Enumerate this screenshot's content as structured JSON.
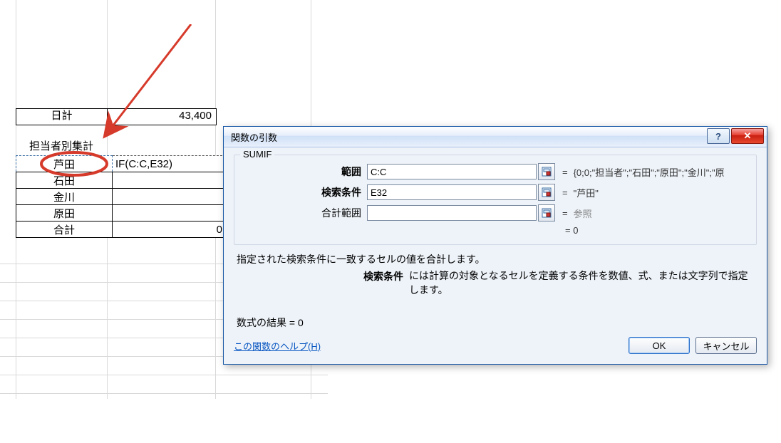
{
  "sheet": {
    "peek": {
      "label": "日計",
      "value": "43,400"
    },
    "header": "担当者別集計",
    "rows": [
      {
        "name": "芦田",
        "formula": "IF(C:C,E32)"
      },
      {
        "name": "石田",
        "formula": ""
      },
      {
        "name": "金川",
        "formula": ""
      },
      {
        "name": "原田",
        "formula": ""
      },
      {
        "name": "合計",
        "formula": "0"
      }
    ]
  },
  "dialog": {
    "title": "関数の引数",
    "function_name": "SUMIF",
    "args": [
      {
        "label": "範囲",
        "value": "C:C",
        "result": "{0;0;\"担当者\";\"石田\";\"原田\";\"金川\";\"原"
      },
      {
        "label": "検索条件",
        "value": "E32",
        "result": "\"芦田\""
      },
      {
        "label": "合計範囲",
        "value": "",
        "result": "参照"
      }
    ],
    "overall_eq": "=  0",
    "description_main": "指定された検索条件に一致するセルの値を合計します。",
    "description_arg_label": "検索条件",
    "description_arg_text": "には計算の対象となるセルを定義する条件を数値、式、または文字列で指定します。",
    "formula_result_label": "数式の結果 = ",
    "formula_result_value": "0",
    "help_link": "この関数のヘルプ(H)",
    "ok": "OK",
    "cancel": "キャンセル",
    "help_symbol": "?",
    "close_symbol": "✕"
  }
}
